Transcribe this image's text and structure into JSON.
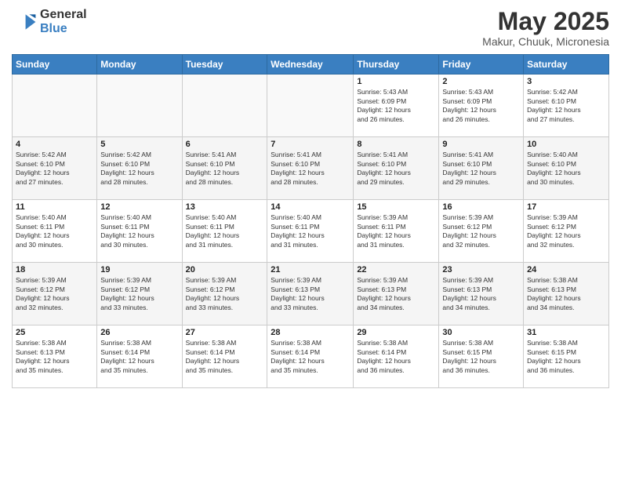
{
  "logo": {
    "general": "General",
    "blue": "Blue"
  },
  "header": {
    "title": "May 2025",
    "subtitle": "Makur, Chuuk, Micronesia"
  },
  "weekdays": [
    "Sunday",
    "Monday",
    "Tuesday",
    "Wednesday",
    "Thursday",
    "Friday",
    "Saturday"
  ],
  "weeks": [
    [
      {
        "day": "",
        "info": ""
      },
      {
        "day": "",
        "info": ""
      },
      {
        "day": "",
        "info": ""
      },
      {
        "day": "",
        "info": ""
      },
      {
        "day": "1",
        "info": "Sunrise: 5:43 AM\nSunset: 6:09 PM\nDaylight: 12 hours\nand 26 minutes."
      },
      {
        "day": "2",
        "info": "Sunrise: 5:43 AM\nSunset: 6:09 PM\nDaylight: 12 hours\nand 26 minutes."
      },
      {
        "day": "3",
        "info": "Sunrise: 5:42 AM\nSunset: 6:10 PM\nDaylight: 12 hours\nand 27 minutes."
      }
    ],
    [
      {
        "day": "4",
        "info": "Sunrise: 5:42 AM\nSunset: 6:10 PM\nDaylight: 12 hours\nand 27 minutes."
      },
      {
        "day": "5",
        "info": "Sunrise: 5:42 AM\nSunset: 6:10 PM\nDaylight: 12 hours\nand 28 minutes."
      },
      {
        "day": "6",
        "info": "Sunrise: 5:41 AM\nSunset: 6:10 PM\nDaylight: 12 hours\nand 28 minutes."
      },
      {
        "day": "7",
        "info": "Sunrise: 5:41 AM\nSunset: 6:10 PM\nDaylight: 12 hours\nand 28 minutes."
      },
      {
        "day": "8",
        "info": "Sunrise: 5:41 AM\nSunset: 6:10 PM\nDaylight: 12 hours\nand 29 minutes."
      },
      {
        "day": "9",
        "info": "Sunrise: 5:41 AM\nSunset: 6:10 PM\nDaylight: 12 hours\nand 29 minutes."
      },
      {
        "day": "10",
        "info": "Sunrise: 5:40 AM\nSunset: 6:10 PM\nDaylight: 12 hours\nand 30 minutes."
      }
    ],
    [
      {
        "day": "11",
        "info": "Sunrise: 5:40 AM\nSunset: 6:11 PM\nDaylight: 12 hours\nand 30 minutes."
      },
      {
        "day": "12",
        "info": "Sunrise: 5:40 AM\nSunset: 6:11 PM\nDaylight: 12 hours\nand 30 minutes."
      },
      {
        "day": "13",
        "info": "Sunrise: 5:40 AM\nSunset: 6:11 PM\nDaylight: 12 hours\nand 31 minutes."
      },
      {
        "day": "14",
        "info": "Sunrise: 5:40 AM\nSunset: 6:11 PM\nDaylight: 12 hours\nand 31 minutes."
      },
      {
        "day": "15",
        "info": "Sunrise: 5:39 AM\nSunset: 6:11 PM\nDaylight: 12 hours\nand 31 minutes."
      },
      {
        "day": "16",
        "info": "Sunrise: 5:39 AM\nSunset: 6:12 PM\nDaylight: 12 hours\nand 32 minutes."
      },
      {
        "day": "17",
        "info": "Sunrise: 5:39 AM\nSunset: 6:12 PM\nDaylight: 12 hours\nand 32 minutes."
      }
    ],
    [
      {
        "day": "18",
        "info": "Sunrise: 5:39 AM\nSunset: 6:12 PM\nDaylight: 12 hours\nand 32 minutes."
      },
      {
        "day": "19",
        "info": "Sunrise: 5:39 AM\nSunset: 6:12 PM\nDaylight: 12 hours\nand 33 minutes."
      },
      {
        "day": "20",
        "info": "Sunrise: 5:39 AM\nSunset: 6:12 PM\nDaylight: 12 hours\nand 33 minutes."
      },
      {
        "day": "21",
        "info": "Sunrise: 5:39 AM\nSunset: 6:13 PM\nDaylight: 12 hours\nand 33 minutes."
      },
      {
        "day": "22",
        "info": "Sunrise: 5:39 AM\nSunset: 6:13 PM\nDaylight: 12 hours\nand 34 minutes."
      },
      {
        "day": "23",
        "info": "Sunrise: 5:39 AM\nSunset: 6:13 PM\nDaylight: 12 hours\nand 34 minutes."
      },
      {
        "day": "24",
        "info": "Sunrise: 5:38 AM\nSunset: 6:13 PM\nDaylight: 12 hours\nand 34 minutes."
      }
    ],
    [
      {
        "day": "25",
        "info": "Sunrise: 5:38 AM\nSunset: 6:13 PM\nDaylight: 12 hours\nand 35 minutes."
      },
      {
        "day": "26",
        "info": "Sunrise: 5:38 AM\nSunset: 6:14 PM\nDaylight: 12 hours\nand 35 minutes."
      },
      {
        "day": "27",
        "info": "Sunrise: 5:38 AM\nSunset: 6:14 PM\nDaylight: 12 hours\nand 35 minutes."
      },
      {
        "day": "28",
        "info": "Sunrise: 5:38 AM\nSunset: 6:14 PM\nDaylight: 12 hours\nand 35 minutes."
      },
      {
        "day": "29",
        "info": "Sunrise: 5:38 AM\nSunset: 6:14 PM\nDaylight: 12 hours\nand 36 minutes."
      },
      {
        "day": "30",
        "info": "Sunrise: 5:38 AM\nSunset: 6:15 PM\nDaylight: 12 hours\nand 36 minutes."
      },
      {
        "day": "31",
        "info": "Sunrise: 5:38 AM\nSunset: 6:15 PM\nDaylight: 12 hours\nand 36 minutes."
      }
    ]
  ]
}
